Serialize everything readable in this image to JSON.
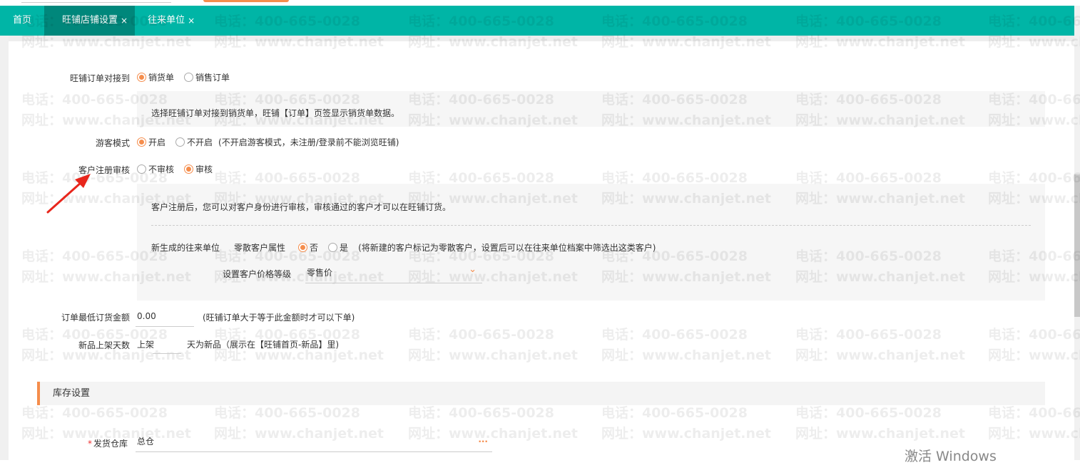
{
  "tabs": [
    {
      "label": "首页"
    },
    {
      "label": "旺铺店铺设置",
      "close": "×"
    },
    {
      "label": "往来单位",
      "close": "×"
    }
  ],
  "form": {
    "order_link": {
      "label": "旺铺订单对接到",
      "options": [
        "销货单",
        "销售订单"
      ],
      "selected": 0,
      "hint": "选择旺铺订单对接到销货单，旺铺【订单】页签显示销货单数据。"
    },
    "guest_mode": {
      "label": "游客模式",
      "options": [
        "开启",
        "不开启"
      ],
      "selected": 0,
      "note": "(不开启游客模式，未注册/登录前不能浏览旺铺)"
    },
    "register_audit": {
      "label": "客户注册审核",
      "options": [
        "不审核",
        "审核"
      ],
      "selected": 1,
      "hint": "客户注册后，您可以对客户身份进行审核，审核通过的客户才可以在旺铺订货。"
    },
    "new_partner": {
      "label": "新生成的往来单位",
      "retail_label": "零散客户属性",
      "options": [
        "否",
        "是"
      ],
      "selected": 0,
      "note": "(将新建的客户标记为零散客户，设置后可以在往来单位档案中筛选出这类客户)",
      "price_label": "设置客户价格等级",
      "price_value": "零售价"
    },
    "min_amount": {
      "label": "订单最低订货金额",
      "value": "0.00",
      "note": "(旺铺订单大于等于此金额时才可以下单)"
    },
    "new_days": {
      "label": "新品上架天数",
      "prefix": "上架",
      "value": "",
      "suffix": "天为新品（展示在【旺铺首页-新品】里)"
    }
  },
  "stock_section": {
    "title": "库存设置",
    "warehouse_label": "发货仓库",
    "required": "*",
    "warehouse_value": "总仓",
    "more": "···"
  },
  "watermark": {
    "phone": "电话：400-665-0028",
    "site": "网址：www.chanjet.net"
  },
  "os_notice": "激活 Windows",
  "colors": {
    "teal": "#00b5a6",
    "active_tab": "#00877b",
    "accent": "#f58d4c",
    "arrow": "#e8261c"
  }
}
